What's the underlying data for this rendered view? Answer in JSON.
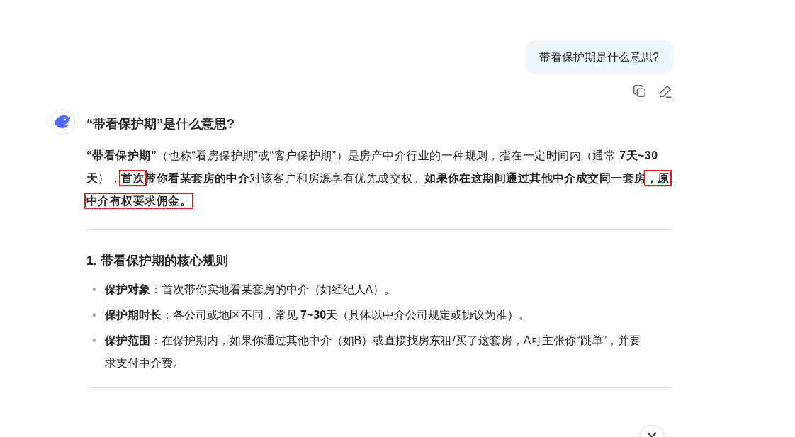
{
  "user_message": {
    "text": "带看保护期是什么意思?"
  },
  "message_actions": [
    {
      "kind": "copy"
    },
    {
      "kind": "edit"
    }
  ],
  "answer": {
    "title": "“带看保护期”是什么意思?",
    "intro": [
      {
        "text": "“带看保护期”",
        "bold": true,
        "boxed": false
      },
      {
        "text": "（也称“看房保护期”或“客户保护期”）是房产中介行业的一种规则，指在一定时间内（通常 ",
        "bold": false,
        "boxed": false
      },
      {
        "text": "7天~30天",
        "bold": true,
        "boxed": false
      },
      {
        "text": "），",
        "bold": false,
        "boxed": false
      },
      {
        "text": "首次",
        "bold": true,
        "boxed": true
      },
      {
        "text": "带你看某套房的中介",
        "bold": true,
        "boxed": false
      },
      {
        "text": "对该客户和房源享有优先成交权。",
        "bold": false,
        "boxed": false
      },
      {
        "text": "如果你在这期间通过其他中介成交同一套房",
        "bold": true,
        "boxed": false
      },
      {
        "text": "，原中介有权要求佣金。",
        "bold": true,
        "boxed": true
      }
    ],
    "section_heading": "1. 带看保护期的核心规则",
    "rules": [
      {
        "marker": "•",
        "text": "**保护对象**：首次带你实地看某套房的中介（如经纪人A）。"
      },
      {
        "marker": "•",
        "text": "**保护期时长**：各公司或地区不同，常见 **7~30天**（具体以中介公司规定或协议为准）。"
      },
      {
        "marker": "•",
        "text": "**保护范围**：在保护期内，如果你通过其他中介（如B）或直接找房东租/买了这套房，A可主张你“跳单”，并要求支付中介费。"
      }
    ]
  },
  "scroll_button": {
    "kind": "down"
  }
}
